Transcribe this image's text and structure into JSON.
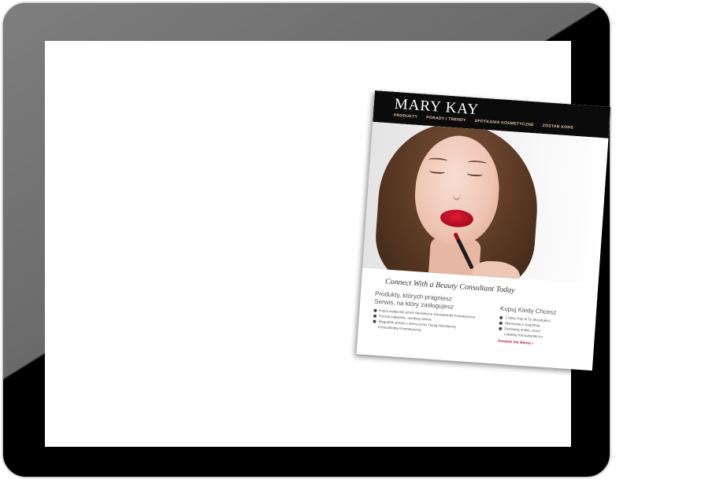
{
  "website": {
    "logo": "MARY KAY",
    "nav": [
      "PRODUKTY",
      "PORADY I TRENDY",
      "SPOTKANIA KOSMETYCZNE",
      "ZOSTAŃ KONS"
    ],
    "tagline": "Connect With a Beauty Consultant Today",
    "left": {
      "heading_line1": "Produkty, których pragniesz",
      "heading_line2": "Serwis, na który zasługujesz",
      "bullets": [
        "Kupuj wyłącznie przez Niezależne Konsultantki Kosmetyczne",
        "Poznaj najlepsze, osobisty serwis",
        "Wygodnie prosto z domu przez Twoją Niezależną",
        "Konsultantkę Kosmetyczną"
      ]
    },
    "right": {
      "heading": "Kupuj Kiedy Chcesz",
      "bullets": [
        "Z Mary Kay to Ty decydujesz",
        "Skorzystaj z wygodnej",
        "Zamawiaj online, przez",
        "Lokalnej Konsultantki Ko"
      ],
      "link": "Dowiedz Się Więcej »"
    }
  },
  "colors": {
    "device_bezel": "#000000",
    "screen": "#ffffff",
    "header_bg": "#0b0b0b",
    "nav_text": "#e8c9a6",
    "lip_red": "#c8102e",
    "link": "#c0183d"
  },
  "icons": [
    "bullet-dot-icon"
  ]
}
